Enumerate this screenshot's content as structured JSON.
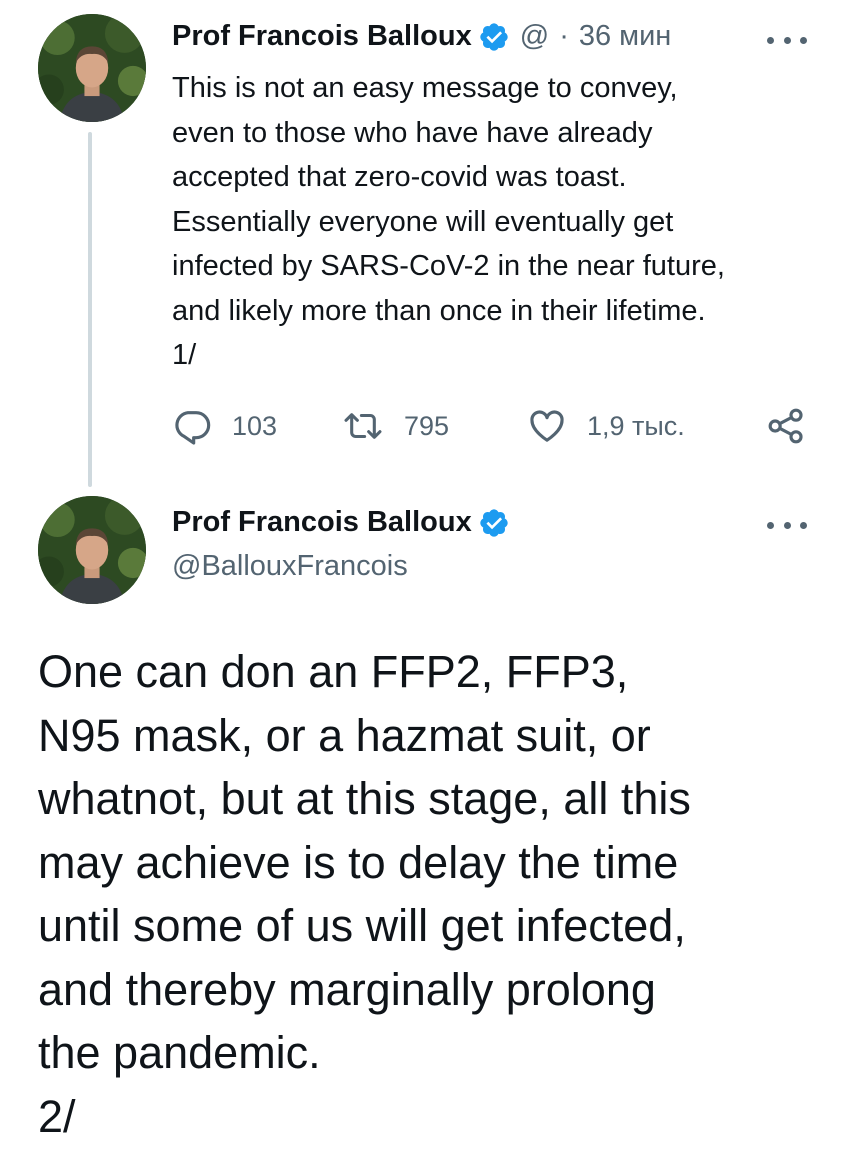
{
  "tweet1": {
    "author_name": "Prof Francois Balloux",
    "handle": "@",
    "separator": "·",
    "time": "36 мин",
    "text": "This is not an easy message to convey,\neven to those who have have already\naccepted that zero-covid was toast.\nEssentially everyone will eventually get\ninfected by SARS-CoV-2 in the near future,\nand likely more than once in their lifetime.\n1/",
    "replies": "103",
    "retweets": "795",
    "likes": "1,9 тыс."
  },
  "tweet2": {
    "author_name": "Prof Francois Balloux",
    "handle": "@BallouxFrancois",
    "text": "One can don an FFP2, FFP3,\nN95 mask, or a hazmat suit, or\nwhatnot, but at this stage, all this\nmay achieve is to delay the time\nuntil some of us will get infected,\nand thereby marginally prolong\nthe pandemic.\n2/"
  },
  "colors": {
    "verified": "#1d9bf0",
    "secondary_text": "#536471",
    "thread_line": "#cfd9de"
  },
  "icons": [
    "verified-badge-icon",
    "more-icon",
    "reply-icon",
    "retweet-icon",
    "like-icon",
    "share-icon"
  ]
}
